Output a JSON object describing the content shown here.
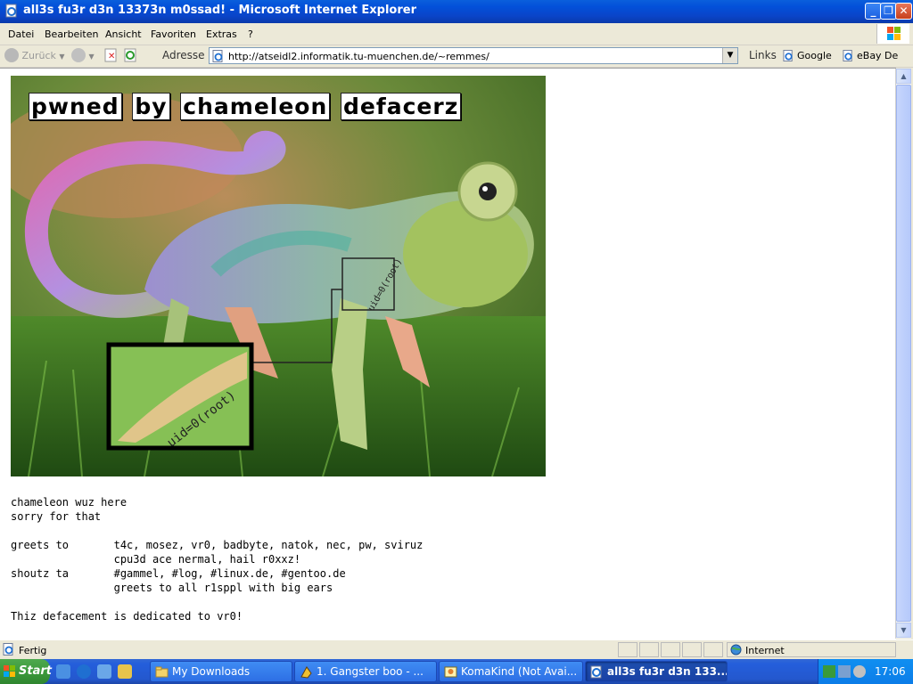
{
  "window": {
    "title": "all3s fu3r d3n 13373n m0ssad! - Microsoft Internet Explorer",
    "app_icon": "ie-page-icon"
  },
  "menu": [
    "Datei",
    "Bearbeiten",
    "Ansicht",
    "Favoriten",
    "Extras",
    "?"
  ],
  "toolbar": {
    "back_label": "Zurück",
    "address_label": "Adresse",
    "url": "http://atseidl2.informatik.tu-muenchen.de/~remmes/",
    "links_label": "Links",
    "links": [
      "Google",
      "eBay De"
    ]
  },
  "page": {
    "banner": [
      "pwned",
      "by",
      "chameleon",
      "defacerz"
    ],
    "zoom_caption": "uid=0(root)",
    "body_text": "chameleon wuz here\nsorry for that\n\ngreets to       t4c, mosez, vr0, badbyte, natok, nec, pw, sviruz\n                cpu3d ace nermal, hail r0xxz!\nshoutz ta       #gammel, #log, #linux.de, #gentoo.de\n                greets to all r1sppl with big ears\n\nThiz defacement is dedicated to vr0!"
  },
  "statusbar": {
    "status": "Fertig",
    "zone": "Internet"
  },
  "taskbar": {
    "start_label": "Start",
    "tasks": [
      {
        "label": "My Downloads",
        "icon": "folder-icon"
      },
      {
        "label": "1. Gangster boo - ...",
        "icon": "winamp-icon"
      },
      {
        "label": "KomaKind (Not Avai...",
        "icon": "messenger-icon"
      },
      {
        "label": "all3s fu3r d3n 133...",
        "icon": "ie-icon"
      }
    ],
    "clock": "17:06"
  },
  "colors": {
    "xp_blue": "#0a44c8",
    "taskbar": "#245edb",
    "start_green": "#3c9a3c",
    "chrome": "#ece9d8"
  }
}
